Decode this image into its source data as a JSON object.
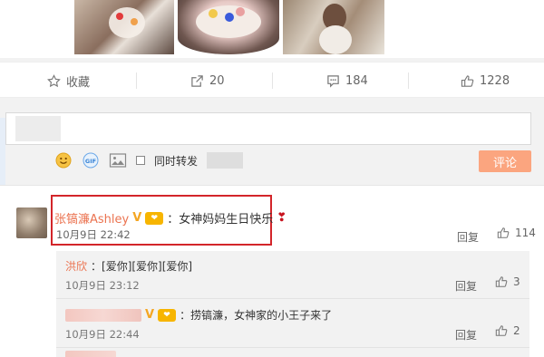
{
  "action_bar": {
    "favorite_label": "收藏",
    "repost_count": "20",
    "comment_count": "184",
    "like_count": "1228"
  },
  "compose": {
    "forward_label": "同时转发",
    "submit_label": "评论"
  },
  "comments": [
    {
      "username": "张镐濂Ashley",
      "text": "：女神妈妈生日快乐",
      "time": "10月9日 22:42",
      "reply_label": "回复",
      "likes": "114",
      "replies": [
        {
          "username": "洪欣",
          "text": "：[爱你][爱你][爱你]",
          "time": "10月9日 23:12",
          "reply_label": "回复",
          "likes": "3"
        },
        {
          "username": "",
          "text": "：捞镐濂，女神家的小王子来了",
          "time": "10月9日 22:44",
          "reply_label": "回复",
          "likes": "2"
        }
      ]
    }
  ],
  "colors": {
    "accent_orange": "#eb7350",
    "submit_bg": "#fba57f",
    "highlight_red": "#d3252a"
  }
}
